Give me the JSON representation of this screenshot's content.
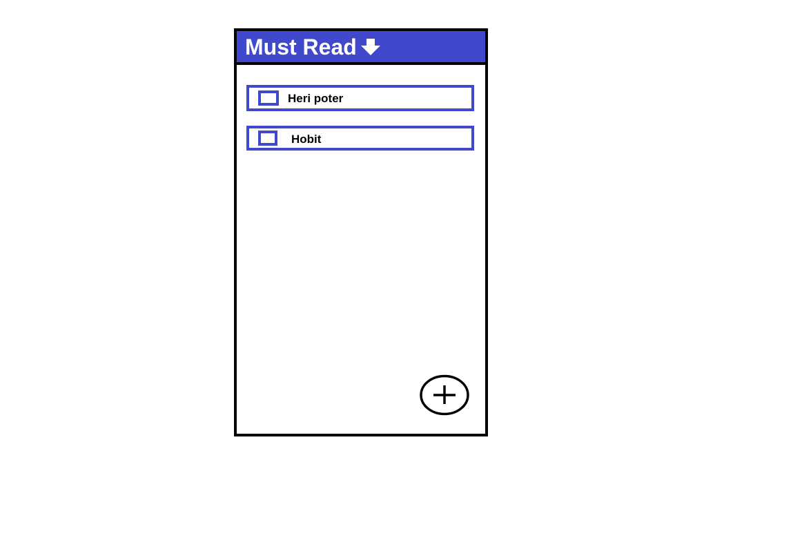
{
  "header": {
    "title": "Must Read",
    "icon": "arrow-down-icon"
  },
  "items": [
    {
      "label": "Heri poter",
      "checked": false
    },
    {
      "label": "Hobit",
      "checked": false
    }
  ],
  "fab": {
    "icon": "plus-icon"
  },
  "colors": {
    "accent": "#4048cc",
    "border": "#000000",
    "background": "#ffffff"
  }
}
